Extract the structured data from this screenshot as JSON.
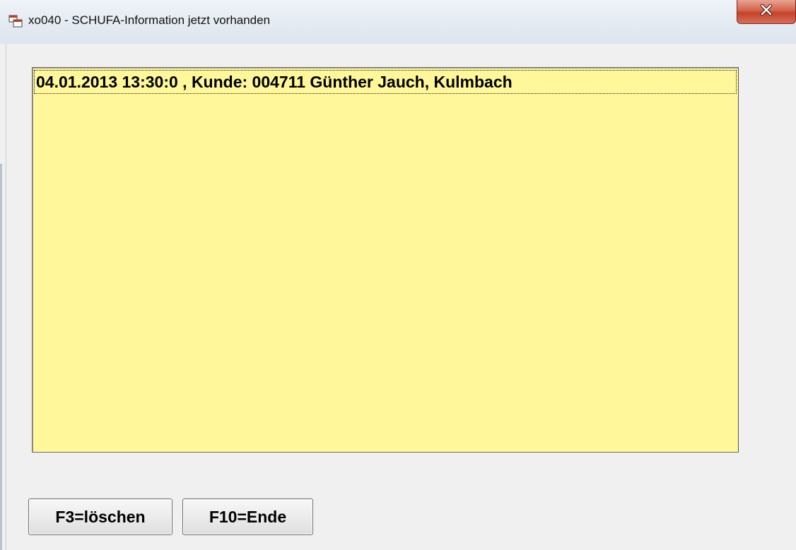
{
  "window": {
    "title": "xo040 - SCHUFA-Information jetzt vorhanden",
    "close_glyph": "×"
  },
  "info": {
    "lines": [
      "04.01.2013 13:30:0 , Kunde: 004711 Günther Jauch, Kulmbach"
    ]
  },
  "buttons": {
    "delete_label": "F3=löschen",
    "end_label": "F10=Ende"
  },
  "colors": {
    "panel_background": "#fff799",
    "window_background": "#f0f0f0",
    "close_button": "#c7412a"
  },
  "icons": {
    "app": "app-window-icon",
    "close": "close-icon"
  }
}
